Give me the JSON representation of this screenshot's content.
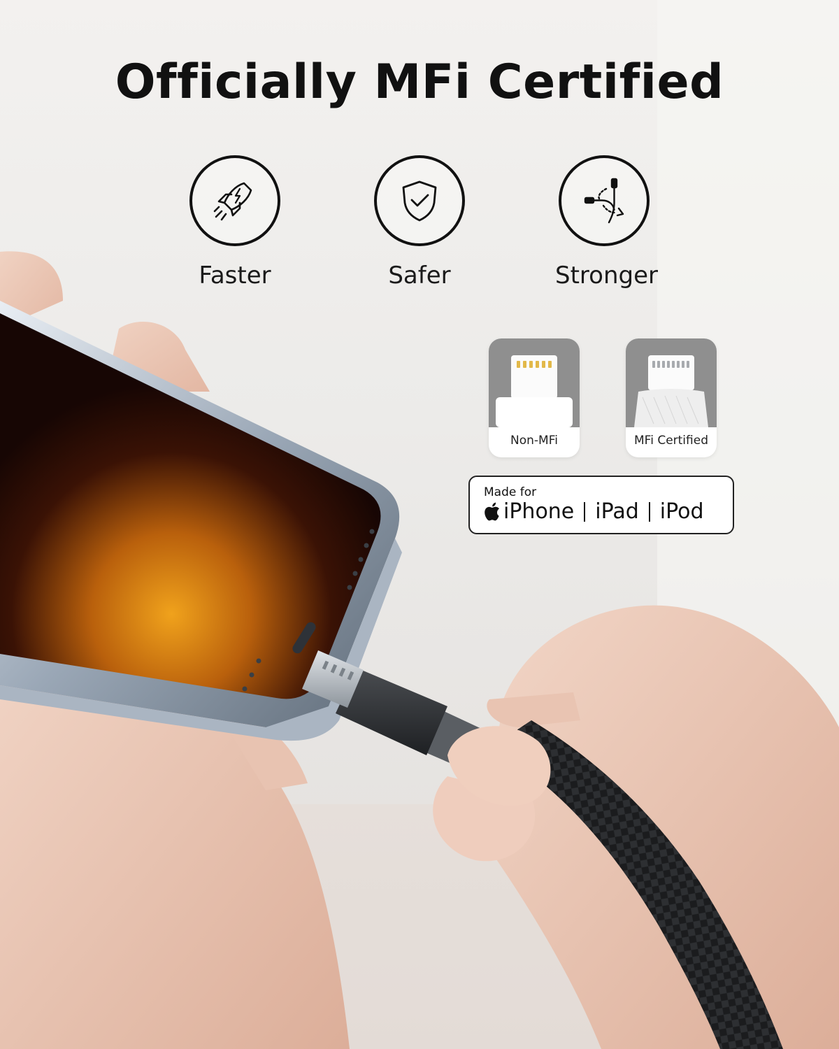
{
  "heading": "Officially MFi Certified",
  "features": [
    {
      "label": "Faster",
      "icon": "rocket-icon"
    },
    {
      "label": "Safer",
      "icon": "shield-check-icon"
    },
    {
      "label": "Stronger",
      "icon": "bend-cable-icon"
    }
  ],
  "comparison": {
    "non_mfi": "Non-MFi",
    "mfi": "MFi Certified"
  },
  "badge": {
    "made_for": "Made for",
    "iphone": "iPhone",
    "ipad": "iPad",
    "ipod": "iPod"
  },
  "colors": {
    "text": "#111111",
    "background": "#eeecea",
    "connector_gold": "#e2b94a",
    "cable_black": "#1a1a1a"
  }
}
